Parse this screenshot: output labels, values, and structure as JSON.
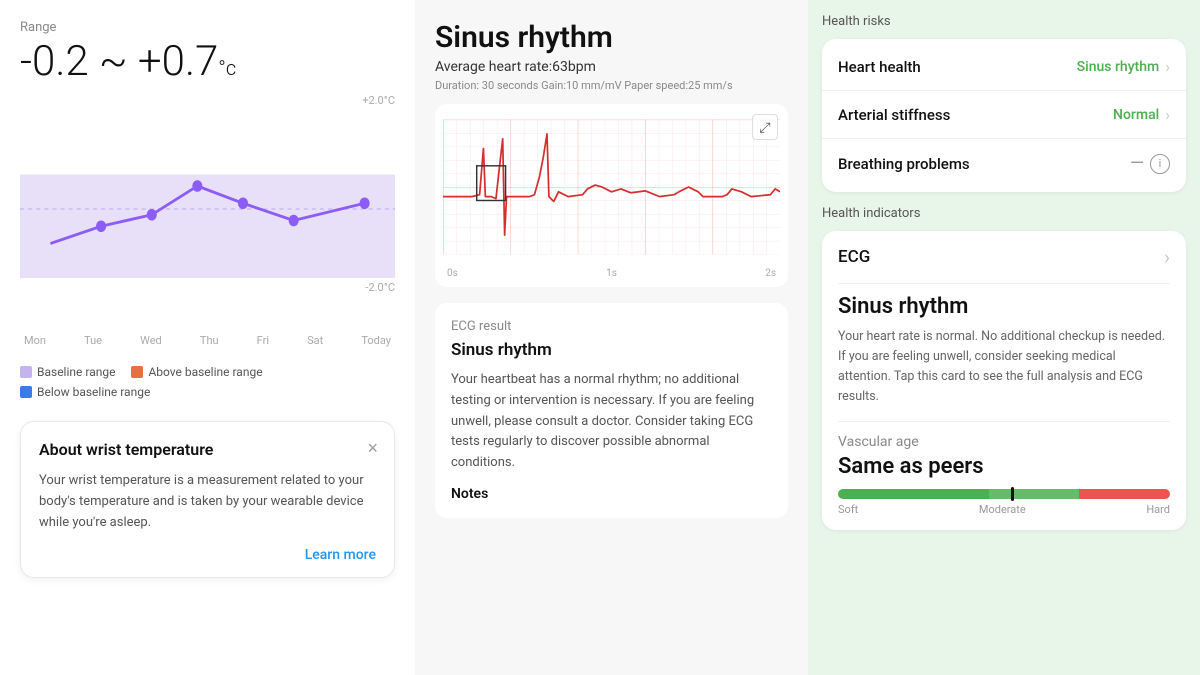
{
  "left": {
    "range_label": "Range",
    "range_value": "-0.2 ~ +0.7",
    "range_unit": "°c",
    "chart": {
      "y_top": "+2.0°C",
      "y_bottom": "-2.0°C",
      "x_labels": [
        "Mon",
        "Tue",
        "Wed",
        "Thu",
        "Fri",
        "Sat",
        "Today"
      ]
    },
    "legend": [
      {
        "label": "Baseline range",
        "color": "#c5b3f0"
      },
      {
        "label": "Above baseline range",
        "color": "#e87040"
      },
      {
        "label": "Below baseline range",
        "color": "#3b7be8"
      }
    ],
    "about_card": {
      "title": "About wrist temperature",
      "text": "Your wrist temperature is a measurement related to your body's temperature and is taken by your wearable device while you're asleep.",
      "learn_more": "Learn more",
      "close": "×"
    }
  },
  "middle": {
    "title": "Sinus rhythm",
    "avg_heart_rate": "Average heart rate:63bpm",
    "meta": "Duration: 30 seconds   Gain:10 mm/mV   Paper speed:25 mm/s",
    "ecg_x_labels": [
      "0s",
      "1s",
      "2s"
    ],
    "ecg_result": {
      "label": "ECG result",
      "title": "Sinus rhythm",
      "text": "Your heartbeat has a normal rhythm; no additional testing or intervention is necessary. If you are feeling unwell, please consult a doctor. Consider taking ECG tests regularly to discover possible abnormal conditions.",
      "notes_label": "Notes"
    }
  },
  "right": {
    "health_risks_label": "Health risks",
    "health_items": [
      {
        "name": "Heart health",
        "value": "Sinus rhythm",
        "type": "green",
        "has_chevron": true
      },
      {
        "name": "Arterial stiffness",
        "value": "Normal",
        "type": "green",
        "has_chevron": true
      },
      {
        "name": "Breathing problems",
        "value": "—",
        "type": "gray",
        "has_chevron": false,
        "has_info": true
      }
    ],
    "health_indicators_label": "Health indicators",
    "ecg_row_label": "ECG",
    "sinus_rhythm": {
      "title": "Sinus rhythm",
      "desc": "Your heart rate is normal. No additional checkup is needed. If you are feeling unwell, consider seeking medical attention. Tap this card to see the full analysis and ECG results."
    },
    "vascular": {
      "label": "Vascular age",
      "title": "Same as peers",
      "bar_labels": [
        "Soft",
        "Moderate",
        "Hard"
      ]
    }
  }
}
